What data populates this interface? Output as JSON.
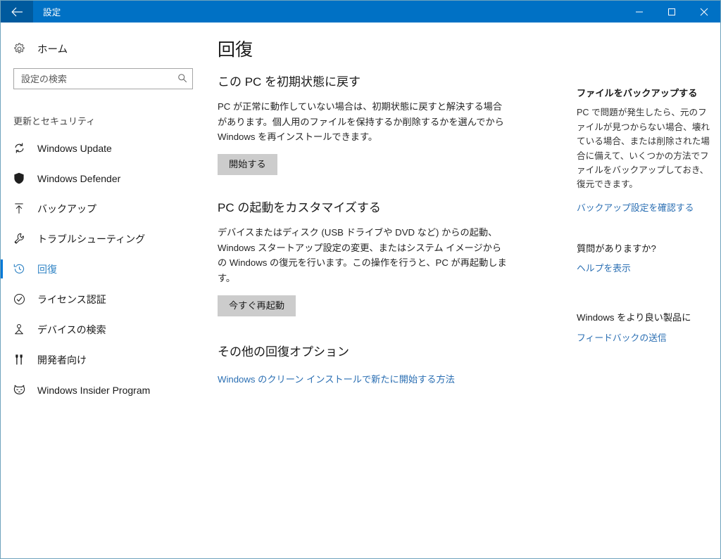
{
  "window": {
    "title": "設定",
    "back_icon": "back-arrow-icon",
    "controls": {
      "minimize": "minimize-icon",
      "maximize": "maximize-icon",
      "close": "close-icon"
    },
    "accent_color": "#0078d7",
    "titlebar_color": "#0071c5",
    "back_button_color": "#005a9e",
    "link_color": "#2b6fb3",
    "button_color": "#cccccc"
  },
  "sidebar": {
    "home": {
      "label": "ホーム",
      "icon": "gear-icon"
    },
    "search": {
      "placeholder": "設定の検索",
      "value": "",
      "icon": "search-icon"
    },
    "group_heading": "更新とセキュリティ",
    "items": [
      {
        "label": "Windows Update",
        "icon": "sync-icon",
        "selected": false
      },
      {
        "label": "Windows Defender",
        "icon": "shield-icon",
        "selected": false
      },
      {
        "label": "バックアップ",
        "icon": "upload-arrow-icon",
        "selected": false
      },
      {
        "label": "トラブルシューティング",
        "icon": "wrench-icon",
        "selected": false
      },
      {
        "label": "回復",
        "icon": "history-clock-icon",
        "selected": true
      },
      {
        "label": "ライセンス認証",
        "icon": "check-circle-icon",
        "selected": false
      },
      {
        "label": "デバイスの検索",
        "icon": "device-locator-icon",
        "selected": false
      },
      {
        "label": "開発者向け",
        "icon": "developer-tools-icon",
        "selected": false
      },
      {
        "label": "Windows Insider Program",
        "icon": "ninjacat-icon",
        "selected": false
      }
    ]
  },
  "main": {
    "page_title": "回復",
    "sections": [
      {
        "title": "この PC を初期状態に戻す",
        "body": "PC が正常に動作していない場合は、初期状態に戻すと解決する場合があります。個人用のファイルを保持するか削除するかを選んでから Windows を再インストールできます。",
        "button": "開始する"
      },
      {
        "title": "PC の起動をカスタマイズする",
        "body": "デバイスまたはディスク (USB ドライブや DVD など) からの起動、Windows スタートアップ設定の変更、またはシステム イメージからの Windows の復元を行います。この操作を行うと、PC が再起動します。",
        "button": "今すぐ再起動"
      }
    ],
    "other_options": {
      "title": "その他の回復オプション",
      "link": "Windows のクリーン インストールで新たに開始する方法"
    }
  },
  "right_rail": {
    "blocks": [
      {
        "title": "ファイルをバックアップする",
        "bold": true,
        "text": "PC で問題が発生したら、元のファイルが見つからない場合、壊れている場合、または削除された場合に備えて、いくつかの方法でファイルをバックアップしておき、復元できます。",
        "link": "バックアップ設定を確認する"
      },
      {
        "title": "質問がありますか?",
        "bold": false,
        "text": "",
        "link": "ヘルプを表示"
      },
      {
        "title": "Windows をより良い製品に",
        "bold": false,
        "text": "",
        "link": "フィードバックの送信"
      }
    ]
  }
}
